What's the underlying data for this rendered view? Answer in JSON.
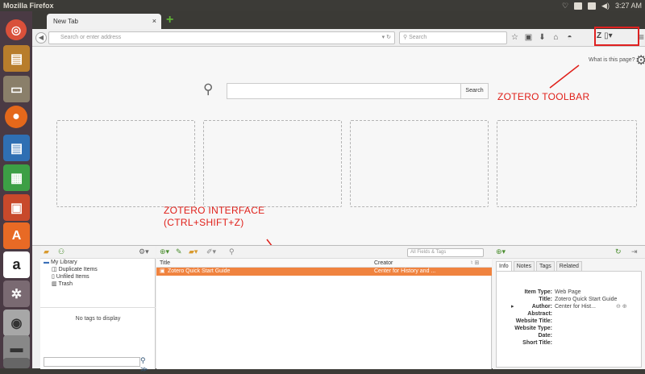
{
  "os": {
    "title": "Mozilla Firefox",
    "clock": "3:27 AM"
  },
  "browser": {
    "tab_title": "New Tab",
    "tab_close": "×",
    "new_tab": "+",
    "url_placeholder": "Search or enter address",
    "search_placeholder": "Search",
    "what_is_this": "What is this page?"
  },
  "newtab": {
    "search_button": "Search"
  },
  "annotations": {
    "zotero_toolbar": "ZOTERO TOOLBAR",
    "zotero_interface_1": "ZOTERO INTERFACE",
    "zotero_interface_2": "(CTRL+SHIFT+Z)"
  },
  "zotero": {
    "library": {
      "root": "My Library",
      "items": [
        "Duplicate Items",
        "Unfiled Items",
        "Trash"
      ]
    },
    "no_tags": "No tags to display",
    "search_placeholder": "All Fields & Tags",
    "columns": {
      "title": "Title",
      "creator": "Creator"
    },
    "rows": [
      {
        "title": "Zotero Quick Start Guide",
        "creator": "Center for History and ..."
      }
    ],
    "tabs": [
      "Info",
      "Notes",
      "Tags",
      "Related"
    ],
    "fields": [
      {
        "label": "Item Type:",
        "value": "Web Page"
      },
      {
        "label": "Title:",
        "value": "Zotero Quick Start Guide"
      },
      {
        "label": "Author:",
        "value": "Center for Hist..."
      },
      {
        "label": "Abstract:",
        "value": ""
      },
      {
        "label": "Website Title:",
        "value": ""
      },
      {
        "label": "Website Type:",
        "value": ""
      },
      {
        "label": "Date:",
        "value": ""
      },
      {
        "label": "Short Title:",
        "value": ""
      }
    ]
  },
  "colors": {
    "annotation_red": "#e0201a",
    "selected_row": "#f0833f",
    "launcher_bg": "#4a3a44"
  }
}
